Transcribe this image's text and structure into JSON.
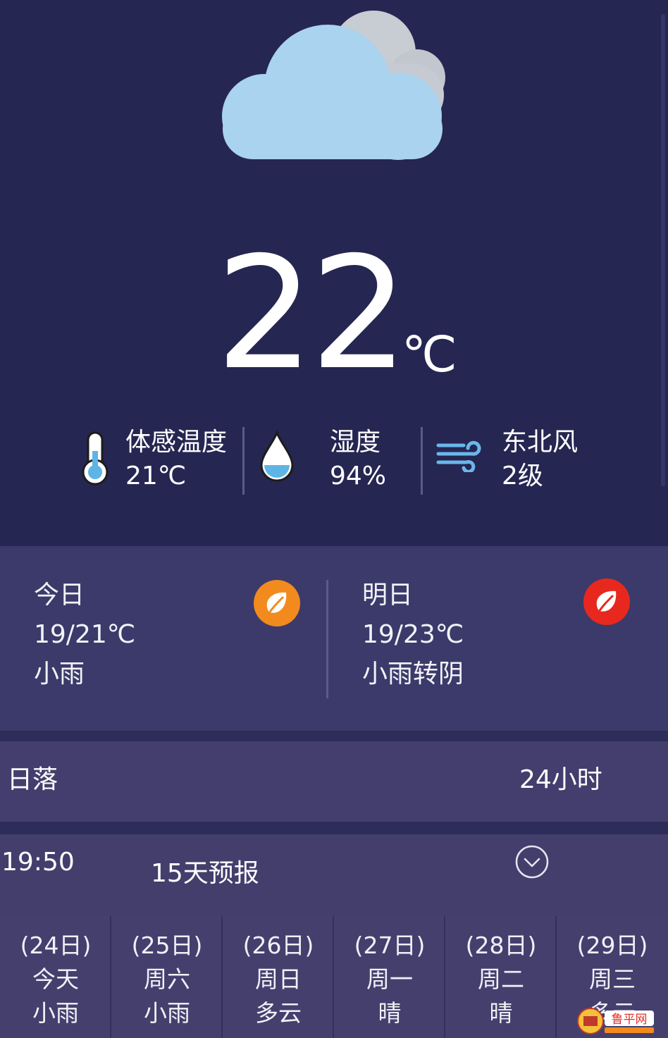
{
  "current": {
    "temperature": "22",
    "unit": "℃"
  },
  "stats": [
    {
      "label": "体感温度",
      "value": "21℃",
      "icon": "thermometer-icon"
    },
    {
      "label": "湿度",
      "value": "94%",
      "icon": "water-drop-icon"
    },
    {
      "label": "东北风",
      "value": "2级",
      "icon": "wind-icon"
    }
  ],
  "today": {
    "label": "今日",
    "range": "19/21℃",
    "condition": "小雨",
    "badge_color": "#f28a1e"
  },
  "tomorrow": {
    "label": "明日",
    "range": "19/23℃",
    "condition": "小雨转阴",
    "badge_color": "#e8281e"
  },
  "sun": {
    "label": "日落",
    "hours_label": "24小时"
  },
  "forecast_row": {
    "time": "19:50",
    "title": "15天预报"
  },
  "days": [
    {
      "date": "(24日)",
      "week": "今天",
      "weather": "小雨"
    },
    {
      "date": "(25日)",
      "week": "周六",
      "weather": "小雨"
    },
    {
      "date": "(26日)",
      "week": "周日",
      "weather": "多云"
    },
    {
      "date": "(27日)",
      "week": "周一",
      "weather": "晴"
    },
    {
      "date": "(28日)",
      "week": "周二",
      "weather": "晴"
    },
    {
      "date": "(29日)",
      "week": "周三",
      "weather": "多云"
    }
  ],
  "watermark": {
    "text": "鲁平网"
  },
  "colors": {
    "background": "#262652",
    "card": "#3c3a6a",
    "cloud": "#a9d3ef",
    "cloud_back": "#c8ccd3"
  }
}
